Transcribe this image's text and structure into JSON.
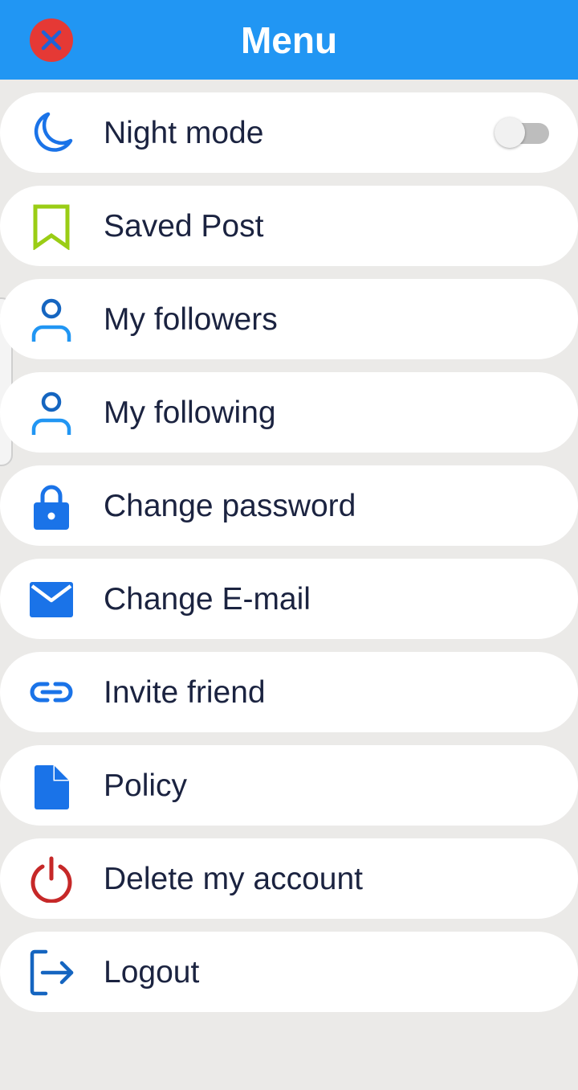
{
  "header": {
    "title": "Menu",
    "close_icon": "close-icon",
    "background_color": "#2196f3"
  },
  "menu": {
    "items": [
      {
        "label": "Night mode",
        "icon": "moon-icon",
        "icon_color": "#1a73e8"
      },
      {
        "label": "Saved Post",
        "icon": "bookmark-icon",
        "icon_color": "#9acd15"
      },
      {
        "label": "My followers",
        "icon": "person-icon",
        "icon_color": "#1e88e5"
      },
      {
        "label": "My following",
        "icon": "person-icon",
        "icon_color": "#1e88e5"
      },
      {
        "label": "Change password",
        "icon": "lock-icon",
        "icon_color": "#1a73e8"
      },
      {
        "label": "Change E-mail",
        "icon": "mail-icon",
        "icon_color": "#1a73e8"
      },
      {
        "label": "Invite friend",
        "icon": "link-icon",
        "icon_color": "#1a73e8"
      },
      {
        "label": "Policy",
        "icon": "document-icon",
        "icon_color": "#1a73e8"
      },
      {
        "label": "Delete my account",
        "icon": "power-icon",
        "icon_color": "#c62828"
      },
      {
        "label": "Logout",
        "icon": "logout-icon",
        "icon_color": "#1565c0"
      }
    ],
    "night_mode_enabled": false
  }
}
